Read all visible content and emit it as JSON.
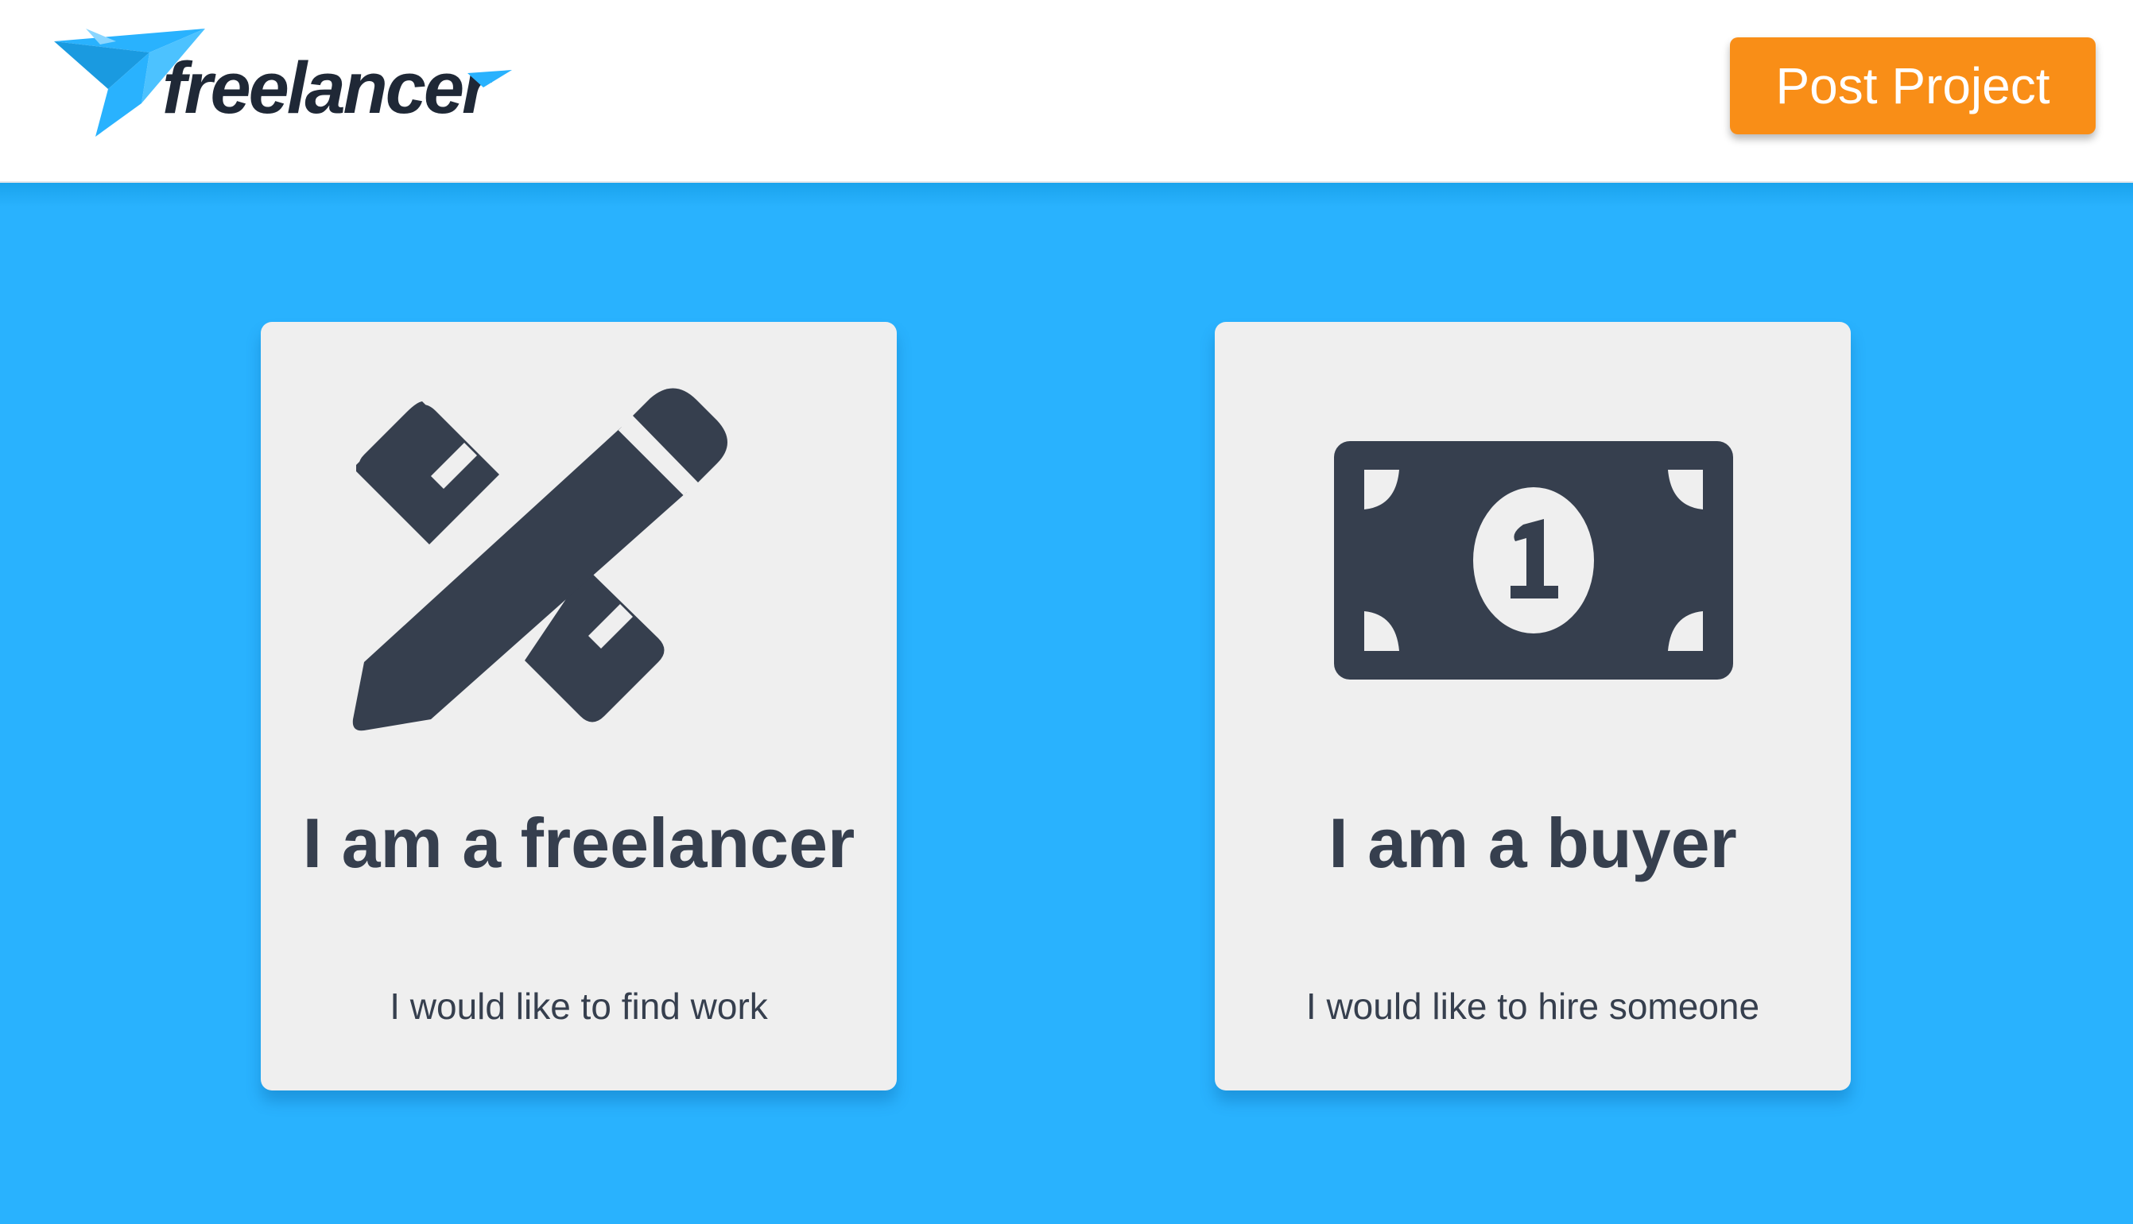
{
  "header": {
    "logo_text": "freelancer",
    "post_project_label": "Post Project"
  },
  "cards": [
    {
      "icon": "pencil-ruler-icon",
      "title": "I am a freelancer",
      "subtitle": "I would like to find work"
    },
    {
      "icon": "dollar-bill-icon",
      "title": "I am a buyer",
      "subtitle": "I would like to hire someone"
    }
  ],
  "colors": {
    "background": "#29b2fe",
    "header": "#ffffff",
    "button": "#f98e17",
    "card": "#efefef",
    "icon_text": "#363f4e",
    "logo_bird": "#29b2fe",
    "logo_text": "#1f2836"
  }
}
